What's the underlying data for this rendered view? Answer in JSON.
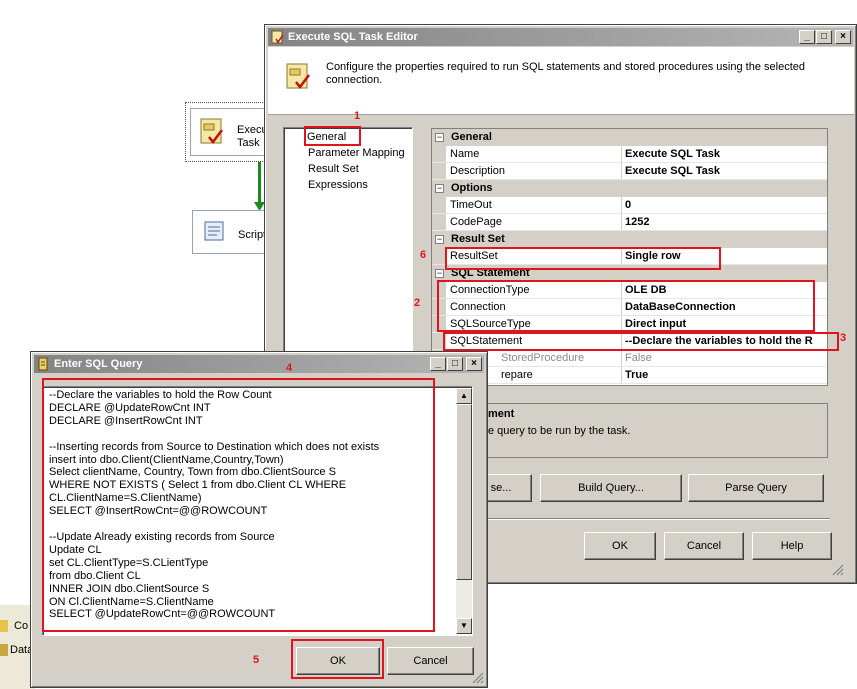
{
  "designer": {
    "task1_line1": "Execu",
    "task1_line2": "Task",
    "task2_label": "Script"
  },
  "bottom_panel": {
    "row1": "Co",
    "row2": "Data"
  },
  "editor": {
    "title": "Execute SQL Task Editor",
    "header_text": "Configure the properties required to run SQL statements and stored procedures using the selected connection.",
    "nav": [
      "General",
      "Parameter Mapping",
      "Result Set",
      "Expressions"
    ],
    "grid": {
      "cat_general": "General",
      "cat_options": "Options",
      "cat_resultset": "Result Set",
      "cat_sqlstatement": "SQL Statement",
      "rows": {
        "name": {
          "label": "Name",
          "value": "Execute SQL Task"
        },
        "description": {
          "label": "Description",
          "value": "Execute SQL Task"
        },
        "timeout": {
          "label": "TimeOut",
          "value": "0"
        },
        "codepage": {
          "label": "CodePage",
          "value": "1252"
        },
        "resultset": {
          "label": "ResultSet",
          "value": "Single row"
        },
        "connectiontype": {
          "label": "ConnectionType",
          "value": "OLE DB"
        },
        "connection": {
          "label": "Connection",
          "value": "DataBaseConnection"
        },
        "sqlsourcetype": {
          "label": "SQLSourceType",
          "value": "Direct input"
        },
        "sqlstatement": {
          "label": "SQLStatement",
          "value": "--Declare the variables to hold the R"
        },
        "isstoredprocedure": {
          "label": "StoredProcedure",
          "value": "False"
        },
        "byPassPrepare": {
          "label": "repare",
          "value": "True"
        }
      }
    },
    "desc_title": "ment",
    "desc_text": "e query to be run by the task.",
    "buttons": {
      "browse": "se...",
      "build_query": "Build Query...",
      "parse_query": "Parse Query",
      "ok": "OK",
      "cancel": "Cancel",
      "help": "Help"
    }
  },
  "query_dialog": {
    "title": "Enter SQL Query",
    "sql": "--Declare the variables to hold the Row Count\nDECLARE @UpdateRowCnt INT\nDECLARE @InsertRowCnt INT\n\n--Inserting records from Source to Destination which does not exists\ninsert into dbo.Client(ClientName,Country,Town)\nSelect clientName, Country, Town from dbo.ClientSource S\nWHERE NOT EXISTS ( Select 1 from dbo.Client CL WHERE\nCL.ClientName=S.ClientName)\nSELECT @InsertRowCnt=@@ROWCOUNT\n\n--Update Already existing records from Source\nUpdate CL\nset CL.ClientType=S.CLientType\nfrom dbo.Client CL\nINNER JOIN dbo.ClientSource S\nON Cl.ClientName=S.ClientName\nSELECT @UpdateRowCnt=@@ROWCOUNT",
    "ok": "OK",
    "cancel": "Cancel"
  },
  "annotations": {
    "n1": "1",
    "n2": "2",
    "n3": "3",
    "n4": "4",
    "n5": "5",
    "n6": "6",
    "color": "#e0141e"
  }
}
